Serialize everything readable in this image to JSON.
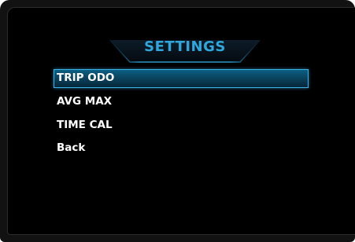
{
  "header": {
    "title": "SETTINGS"
  },
  "menu": {
    "items": [
      {
        "label": "TRIP ODO",
        "selected": true
      },
      {
        "label": "AVG MAX",
        "selected": false
      },
      {
        "label": "TIME CAL",
        "selected": false
      },
      {
        "label": "Back",
        "selected": false
      }
    ]
  },
  "colors": {
    "accent": "#2fa6dc",
    "highlight_border": "#3ab4e8",
    "background": "#000000",
    "bezel": "#121212",
    "text": "#ffffff"
  }
}
